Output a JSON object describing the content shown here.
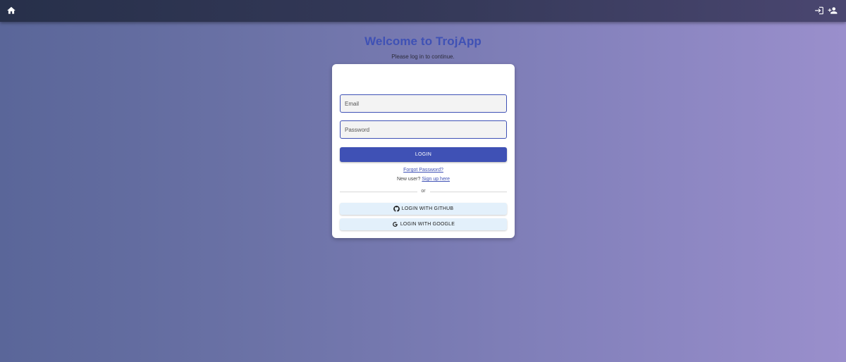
{
  "header": {
    "home_icon": "home-icon",
    "login_icon": "login-icon",
    "signup_icon": "person-add-icon"
  },
  "welcome": {
    "title": "Welcome to TrojApp",
    "subtitle": "Please log in to continue."
  },
  "form": {
    "email_placeholder": "Email",
    "email_value": "",
    "password_placeholder": "Password",
    "password_value": "",
    "login_label": "LOGIN",
    "forgot_label": "Forgot Password?",
    "new_user_text": "New user?",
    "signup_label": "Sign up here",
    "divider_text": "or",
    "github_label": "LOGIN WITH GITHUB",
    "github_icon": "github-icon",
    "google_label": "LOGIN WITH GOOGLE",
    "google_icon": "google-icon"
  },
  "colors": {
    "primary": "#3f51b5",
    "topbar": "#27304a",
    "social_button_bg": "#e3f0fb"
  }
}
